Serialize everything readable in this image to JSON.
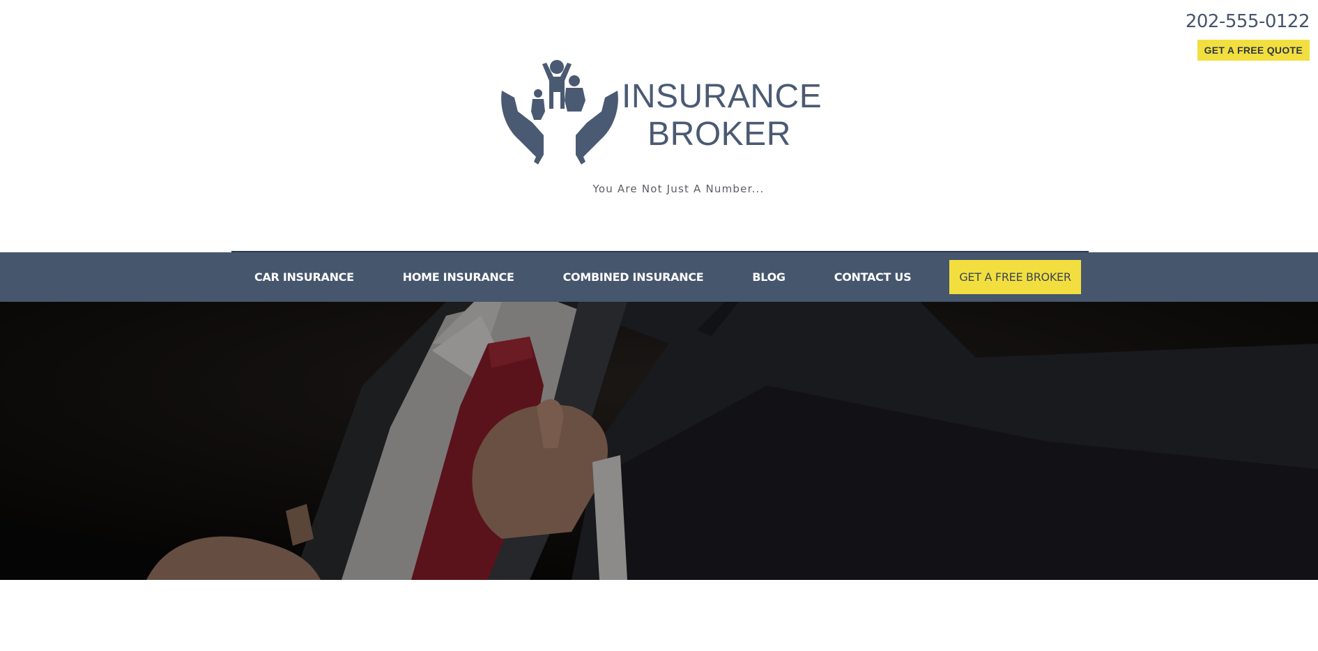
{
  "header": {
    "phone": "202-555-0122",
    "quote_button": "GET A FREE QUOTE"
  },
  "logo": {
    "line1": "INSURANCE",
    "line2": "BROKER",
    "icon": "family-in-hands-icon"
  },
  "tagline": "You Are Not Just A Number...",
  "nav": {
    "items": [
      {
        "label": "CAR INSURANCE"
      },
      {
        "label": "HOME INSURANCE"
      },
      {
        "label": "COMBINED INSURANCE"
      },
      {
        "label": "BLOG"
      },
      {
        "label": "CONTACT US"
      }
    ],
    "cta": "GET A FREE BROKER"
  },
  "colors": {
    "brand": "#46566d",
    "accent": "#f2df3f",
    "text": "#4a5a72"
  },
  "hero": {
    "image": "businessman-adjusting-suit-jacket"
  }
}
